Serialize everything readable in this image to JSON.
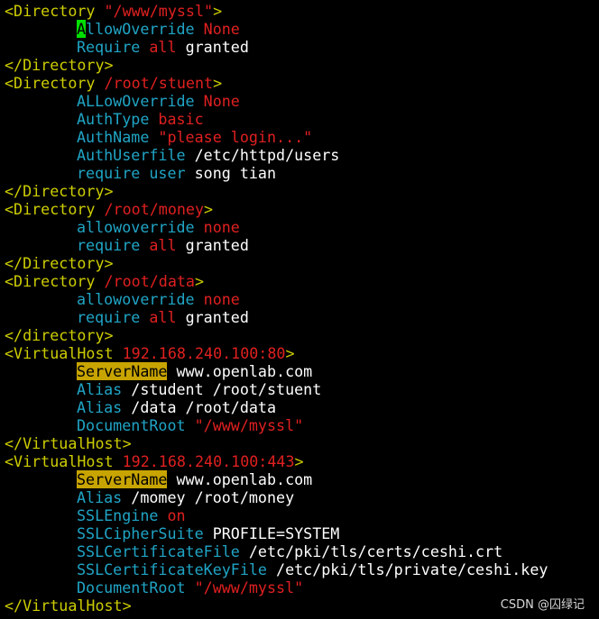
{
  "colors": {
    "background": "#000000",
    "tag": "#cdcd00",
    "directive": "#20a5c6",
    "value": "#e02020",
    "text": "#ffffff",
    "highlight": "#c8a400",
    "cursor": "#00e000"
  },
  "lines": [
    {
      "indent": false,
      "tokens": [
        {
          "t": "tag",
          "v": "<Directory "
        },
        {
          "t": "val",
          "v": "\"/www/myssl\""
        },
        {
          "t": "tag",
          "v": ">"
        }
      ]
    },
    {
      "indent": true,
      "tokens": [
        {
          "t": "cursor",
          "v": "A"
        },
        {
          "t": "dir",
          "v": "llowOverride "
        },
        {
          "t": "val",
          "v": "None"
        }
      ]
    },
    {
      "indent": true,
      "tokens": [
        {
          "t": "dir",
          "v": "Require "
        },
        {
          "t": "val",
          "v": "all "
        },
        {
          "t": "txt",
          "v": "granted"
        }
      ]
    },
    {
      "indent": false,
      "tokens": [
        {
          "t": "tag",
          "v": "</Directory>"
        }
      ]
    },
    {
      "indent": false,
      "tokens": [
        {
          "t": "tag",
          "v": "<Directory "
        },
        {
          "t": "val",
          "v": "/root/stuent"
        },
        {
          "t": "tag",
          "v": ">"
        }
      ]
    },
    {
      "indent": true,
      "tokens": [
        {
          "t": "dir",
          "v": "ALLowOverride "
        },
        {
          "t": "val",
          "v": "None"
        }
      ]
    },
    {
      "indent": true,
      "tokens": [
        {
          "t": "dir",
          "v": "AuthType "
        },
        {
          "t": "val",
          "v": "basic"
        }
      ]
    },
    {
      "indent": true,
      "tokens": [
        {
          "t": "dir",
          "v": "AuthName "
        },
        {
          "t": "val",
          "v": "\"please login...\""
        }
      ]
    },
    {
      "indent": true,
      "tokens": [
        {
          "t": "dir",
          "v": "AuthUserfile "
        },
        {
          "t": "txt",
          "v": "/etc/httpd/users"
        }
      ]
    },
    {
      "indent": true,
      "tokens": [
        {
          "t": "dir",
          "v": "require user "
        },
        {
          "t": "txt",
          "v": "song tian"
        }
      ]
    },
    {
      "indent": false,
      "tokens": [
        {
          "t": "tag",
          "v": "</Directory>"
        }
      ]
    },
    {
      "indent": false,
      "tokens": [
        {
          "t": "tag",
          "v": "<Directory "
        },
        {
          "t": "val",
          "v": "/root/money"
        },
        {
          "t": "tag",
          "v": ">"
        }
      ]
    },
    {
      "indent": true,
      "tokens": [
        {
          "t": "dir",
          "v": "allowoverride "
        },
        {
          "t": "val",
          "v": "none"
        }
      ]
    },
    {
      "indent": true,
      "tokens": [
        {
          "t": "dir",
          "v": "require "
        },
        {
          "t": "val",
          "v": "all "
        },
        {
          "t": "txt",
          "v": "granted"
        }
      ]
    },
    {
      "indent": false,
      "tokens": [
        {
          "t": "tag",
          "v": "</Directory>"
        }
      ]
    },
    {
      "indent": false,
      "tokens": [
        {
          "t": "tag",
          "v": "<Directory "
        },
        {
          "t": "val",
          "v": "/root/data"
        },
        {
          "t": "tag",
          "v": ">"
        }
      ]
    },
    {
      "indent": true,
      "tokens": [
        {
          "t": "dir",
          "v": "allowoverride "
        },
        {
          "t": "val",
          "v": "none"
        }
      ]
    },
    {
      "indent": true,
      "tokens": [
        {
          "t": "dir",
          "v": "require "
        },
        {
          "t": "val",
          "v": "all "
        },
        {
          "t": "txt",
          "v": "granted"
        }
      ]
    },
    {
      "indent": false,
      "tokens": [
        {
          "t": "tag",
          "v": "</directory>"
        }
      ]
    },
    {
      "indent": false,
      "tokens": [
        {
          "t": "tag",
          "v": "<VirtualHost "
        },
        {
          "t": "val",
          "v": "192.168.240.100:80"
        },
        {
          "t": "tag",
          "v": ">"
        }
      ]
    },
    {
      "indent": true,
      "tokens": [
        {
          "t": "hl",
          "v": "ServerName"
        },
        {
          "t": "txt",
          "v": " www.openlab.com"
        }
      ]
    },
    {
      "indent": true,
      "tokens": [
        {
          "t": "dir",
          "v": "Alias "
        },
        {
          "t": "txt",
          "v": "/student /root/stuent"
        }
      ]
    },
    {
      "indent": true,
      "tokens": [
        {
          "t": "dir",
          "v": "Alias "
        },
        {
          "t": "txt",
          "v": "/data /root/data"
        }
      ]
    },
    {
      "indent": true,
      "tokens": [
        {
          "t": "dir",
          "v": "DocumentRoot "
        },
        {
          "t": "val",
          "v": "\"/www/myssl\""
        }
      ]
    },
    {
      "indent": false,
      "tokens": [
        {
          "t": "tag",
          "v": "</VirtualHost>"
        }
      ]
    },
    {
      "indent": false,
      "tokens": [
        {
          "t": "tag",
          "v": "<VirtualHost "
        },
        {
          "t": "val",
          "v": "192.168.240.100:443"
        },
        {
          "t": "tag",
          "v": ">"
        }
      ]
    },
    {
      "indent": true,
      "tokens": [
        {
          "t": "hl",
          "v": "ServerName"
        },
        {
          "t": "txt",
          "v": " www.openlab.com"
        }
      ]
    },
    {
      "indent": true,
      "tokens": [
        {
          "t": "dir",
          "v": "Alias "
        },
        {
          "t": "txt",
          "v": "/momey /root/money"
        }
      ]
    },
    {
      "indent": true,
      "tokens": [
        {
          "t": "dir",
          "v": "SSLEngine "
        },
        {
          "t": "val",
          "v": "on"
        }
      ]
    },
    {
      "indent": true,
      "tokens": [
        {
          "t": "dir",
          "v": "SSLCipherSuite "
        },
        {
          "t": "txt",
          "v": "PROFILE=SYSTEM"
        }
      ]
    },
    {
      "indent": true,
      "tokens": [
        {
          "t": "dir",
          "v": "SSLCertificateFile "
        },
        {
          "t": "txt",
          "v": "/etc/pki/tls/certs/ceshi.crt"
        }
      ]
    },
    {
      "indent": true,
      "tokens": [
        {
          "t": "dir",
          "v": "SSLCertificateKeyFile "
        },
        {
          "t": "txt",
          "v": "/etc/pki/tls/private/ceshi.key"
        }
      ]
    },
    {
      "indent": true,
      "tokens": [
        {
          "t": "dir",
          "v": "DocumentRoot "
        },
        {
          "t": "val",
          "v": "\"/www/myssl\""
        }
      ]
    },
    {
      "indent": false,
      "tokens": [
        {
          "t": "tag",
          "v": "</VirtualHost>"
        }
      ]
    }
  ],
  "watermark": "CSDN @囚绿记"
}
